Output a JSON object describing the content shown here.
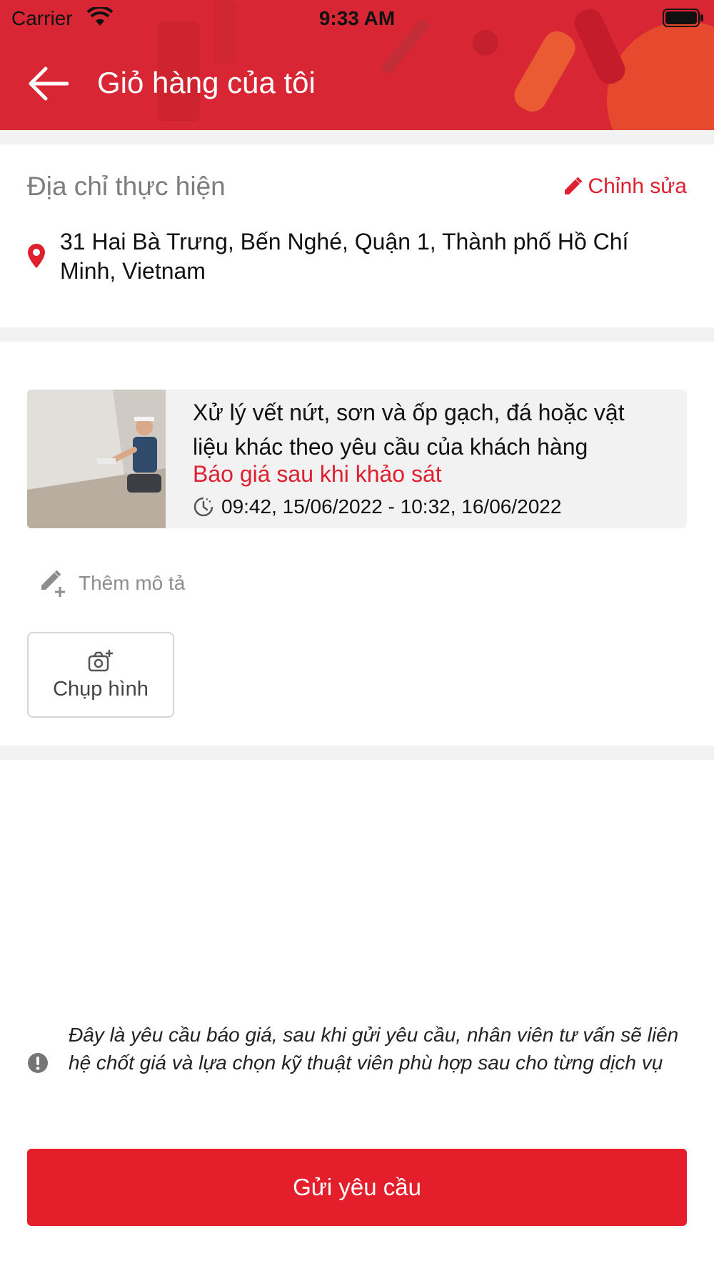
{
  "status_bar": {
    "carrier": "Carrier",
    "time": "9:33 AM"
  },
  "header": {
    "title": "Giỏ hàng của tôi"
  },
  "address_section": {
    "title": "Địa chỉ thực hiện",
    "edit_label": "Chỉnh sửa",
    "address": "31 Hai Bà Trưng, Bến Nghé, Quận 1, Thành phố Hồ Chí Minh, Vietnam"
  },
  "service": {
    "name": "Xử lý vết nứt, sơn và ốp gạch, đá hoặc vật liệu khác theo yêu cầu của khách hàng",
    "price_text": "Báo giá sau khi khảo sát",
    "time_range": "09:42, 15/06/2022 - 10:32, 16/06/2022"
  },
  "description": {
    "add_label": "Thêm mô tả"
  },
  "photo": {
    "label": "Chụp hình"
  },
  "note": {
    "text": "Đây là yêu cầu báo giá, sau khi gửi yêu cầu, nhân viên tư vấn sẽ liên hệ chốt giá và lựa chọn kỹ thuật viên phù hợp sau cho từng dịch vụ"
  },
  "submit": {
    "label": "Gửi yêu cầu"
  },
  "colors": {
    "brand_red": "#e51e2b",
    "header_red": "#d92634",
    "gray_bg": "#f2f2f2"
  }
}
